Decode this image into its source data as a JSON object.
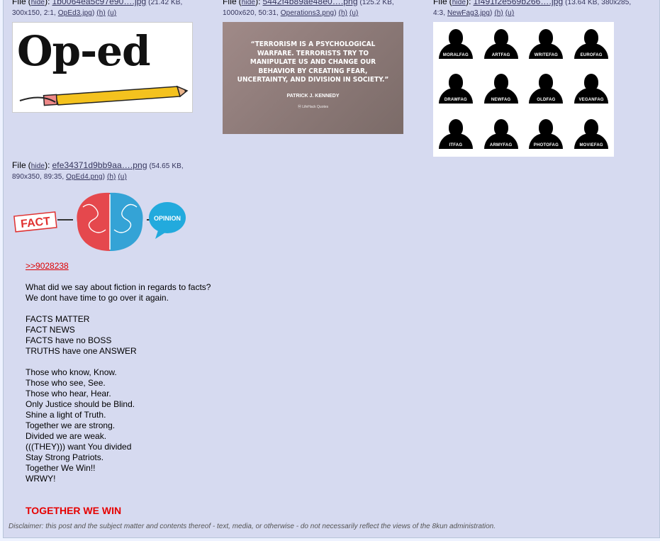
{
  "files": [
    {
      "label": "File",
      "hide": "hide",
      "filename": "1b0064ea5c97e90….jpg",
      "meta": "(21.42 KB, 300x150, 2:1,",
      "orig_name": "OpEd3.jpg",
      "h": "(h)",
      "u": "(u)",
      "thumb_text": "Op-ed"
    },
    {
      "label": "File",
      "hide": "hide",
      "filename": "5442f4b89ae48e0….png",
      "meta": "(125.2 KB, 1000x620, 50:31,",
      "orig_name": "Operations3.png",
      "h": "(h)",
      "u": "(u)",
      "quote": "“Terrorism is a psychological warfare. Terrorists try to manipulate us and change our behavior by creating fear, uncertainty, and division in society.”",
      "author": "PATRICK J. KENNEDY",
      "source": "Ⓜ LifeHack Quotes"
    },
    {
      "label": "File",
      "hide": "hide",
      "filename": "1f491f2e569b266….jpg",
      "meta": "(13.64 KB, 380x285, 4:3,",
      "orig_name": "NewFag3.jpg",
      "h": "(h)",
      "u": "(u)",
      "grid": [
        "MORALFAG",
        "ARTFAG",
        "WRITEFAG",
        "EUROFAG",
        "DRAWFAG",
        "NEWFAG",
        "OLDFAG",
        "VEGANFAG",
        "ITFAG",
        "ARMYFAG",
        "PHOTOFAG",
        "MOVIEFAG"
      ]
    },
    {
      "label": "File",
      "hide": "hide",
      "filename": "efe34371d9bb9aa….png",
      "meta": "(54.65 KB, 890x350, 89:35,",
      "orig_name": "OpEd4.png",
      "h": "(h)",
      "u": "(u)",
      "left_word": "FACT",
      "right_word": "OPINION"
    }
  ],
  "body": {
    "quotelink": ">>9028238",
    "lines": [
      "What did we say about fiction in regards to facts?",
      "We dont have time to go over it again.",
      "",
      "FACTS MATTER",
      "FACT NEWS",
      "FACTS have no BOSS",
      "TRUTHS have one ANSWER",
      "",
      "Those who know, Know.",
      "Those who see, See.",
      "Those who hear, Hear.",
      "Only Justice should be Blind.",
      "Shine a light of Truth.",
      "Together we are strong.",
      "Divided we are weak.",
      "(((THEY))) want You divided",
      "Stay Strong Patriots.",
      "Together We Win!!",
      "WRWY!",
      "",
      ""
    ],
    "closing": "TOGETHER WE WIN"
  },
  "disclaimer": "Disclaimer: this post and the subject matter and contents thereof - text, media, or otherwise - do not necessarily reflect the views of the 8kun administration.",
  "colors": {
    "page_bg": "#eef2ff",
    "post_bg": "#d6daf0",
    "link": "#34345c",
    "quotelink": "#dd0000",
    "accent_red": "#e60000"
  }
}
